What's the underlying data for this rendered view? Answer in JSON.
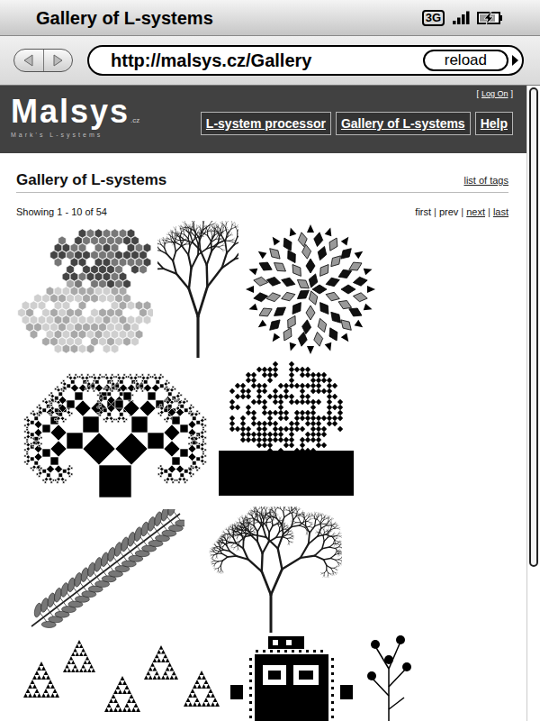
{
  "status_bar": {
    "title": "Gallery of L-systems",
    "network": "3G",
    "signal": {
      "level": 1
    },
    "battery": {
      "level": 0.85,
      "charging": true
    }
  },
  "toolbar": {
    "url": "http://malsys.cz/Gallery",
    "reload": "reload"
  },
  "site": {
    "logo": "Malsys",
    "logo_suffix": ".cz",
    "tagline": "Mark's L-systems",
    "login": {
      "open": "[",
      "label": "Log On",
      "close": "]"
    },
    "nav": [
      {
        "label": "L-system processor"
      },
      {
        "label": "Gallery of L-systems"
      },
      {
        "label": "Help"
      }
    ]
  },
  "content": {
    "title": "Gallery of L-systems",
    "tags_link": "list of tags",
    "showing": "Showing 1 - 10 of 54",
    "pager_separator": "|",
    "pager": [
      {
        "label": "first",
        "enabled": false
      },
      {
        "label": "prev",
        "enabled": false
      },
      {
        "label": "next",
        "enabled": true
      },
      {
        "label": "last",
        "enabled": true
      }
    ]
  },
  "gallery": [
    {
      "kind": "gosper"
    },
    {
      "kind": "tree"
    },
    {
      "kind": "penrose"
    },
    {
      "kind": "pythagoras"
    },
    {
      "kind": "dragon"
    },
    {
      "kind": "branch"
    },
    {
      "kind": "willow"
    },
    {
      "kind": "sierpinski"
    },
    {
      "kind": "blocks"
    },
    {
      "kind": "plant"
    }
  ],
  "scrollbar": {
    "level": 0.76
  }
}
